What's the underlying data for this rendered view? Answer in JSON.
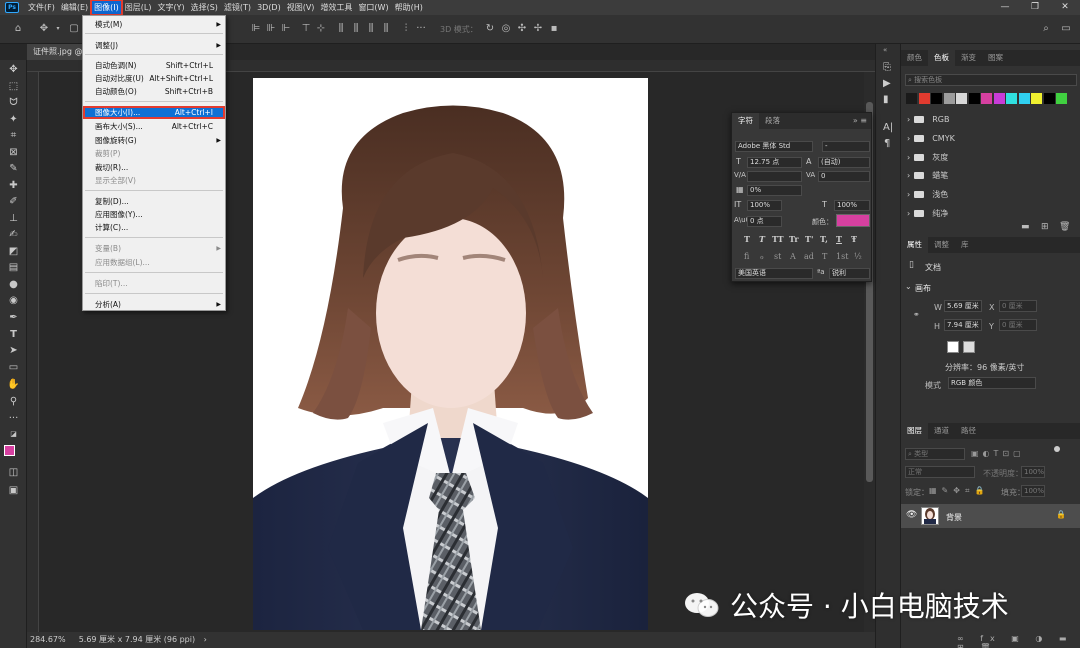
{
  "menubar": {
    "items": [
      "文件(F)",
      "编辑(E)",
      "图像(I)",
      "图层(L)",
      "文字(Y)",
      "选择(S)",
      "滤镜(T)",
      "3D(D)",
      "视图(V)",
      "增效工具",
      "窗口(W)",
      "帮助(H)"
    ],
    "active_index": 2
  },
  "options_bar": {
    "mode_3d": "3D 模式："
  },
  "document": {
    "tab_title": "证件照.jpg @"
  },
  "image_menu": {
    "items": [
      {
        "label": "模式(M)",
        "shortcut": "",
        "submenu": true,
        "disabled": false
      },
      {
        "label": "调整(J)",
        "shortcut": "",
        "submenu": true,
        "disabled": false
      },
      {
        "label": "自动色调(N)",
        "shortcut": "Shift+Ctrl+L",
        "submenu": false,
        "disabled": false
      },
      {
        "label": "自动对比度(U)",
        "shortcut": "Alt+Shift+Ctrl+L",
        "submenu": false,
        "disabled": false
      },
      {
        "label": "自动颜色(O)",
        "shortcut": "Shift+Ctrl+B",
        "submenu": false,
        "disabled": false
      },
      {
        "label": "图像大小(I)...",
        "shortcut": "Alt+Ctrl+I",
        "submenu": false,
        "disabled": false,
        "highlighted": true
      },
      {
        "label": "画布大小(S)...",
        "shortcut": "Alt+Ctrl+C",
        "submenu": false,
        "disabled": false
      },
      {
        "label": "图像旋转(G)",
        "shortcut": "",
        "submenu": true,
        "disabled": false
      },
      {
        "label": "裁剪(P)",
        "shortcut": "",
        "submenu": false,
        "disabled": true
      },
      {
        "label": "裁切(R)...",
        "shortcut": "",
        "submenu": false,
        "disabled": false
      },
      {
        "label": "显示全部(V)",
        "shortcut": "",
        "submenu": false,
        "disabled": true
      },
      {
        "label": "复制(D)...",
        "shortcut": "",
        "submenu": false,
        "disabled": false
      },
      {
        "label": "应用图像(Y)...",
        "shortcut": "",
        "submenu": false,
        "disabled": false
      },
      {
        "label": "计算(C)...",
        "shortcut": "",
        "submenu": false,
        "disabled": false
      },
      {
        "label": "变量(B)",
        "shortcut": "",
        "submenu": true,
        "disabled": true
      },
      {
        "label": "应用数据组(L)...",
        "shortcut": "",
        "submenu": false,
        "disabled": true
      },
      {
        "label": "陷印(T)...",
        "shortcut": "",
        "submenu": false,
        "disabled": true
      },
      {
        "label": "分析(A)",
        "shortcut": "",
        "submenu": true,
        "disabled": false
      }
    ]
  },
  "character_panel": {
    "tabs": [
      "字符",
      "段落"
    ],
    "font_family": "Adobe 黑体 Std",
    "font_style": "-",
    "font_size": "12.75 点",
    "leading": "(自动)",
    "kerning": "",
    "tracking": "0",
    "scale_ratio": "0%",
    "vertical_scale": "100%",
    "horizontal_scale": "100%",
    "baseline_shift": "0 点",
    "color_label": "颜色：",
    "color": "#d640a0",
    "style_buttons": [
      "T",
      "T",
      "TT",
      "Tr",
      "T'",
      "T,",
      "T",
      "Ŧ"
    ],
    "opentype_buttons": [
      "fi",
      "ℴ",
      "st",
      "A",
      "ad",
      "T",
      "1st",
      "½"
    ],
    "language": "美国英语",
    "antialias": "锐利"
  },
  "color_panel": {
    "tabs": [
      "颜色",
      "色板",
      "渐变",
      "图案"
    ],
    "active_tab": "色板",
    "search_placeholder": "搜索色板",
    "swatches": [
      "#1a1a1a",
      "#e23b2f",
      "#000000",
      "#9c9c9c",
      "#d8d8d8",
      "#000000",
      "#d640a0",
      "#c83cd8",
      "#30e0e0",
      "#30d0f0",
      "#f0f030",
      "#000000",
      "#40d040"
    ],
    "folders": [
      "RGB",
      "CMYK",
      "灰度",
      "蜡笔",
      "浅色",
      "纯净"
    ]
  },
  "properties_panel": {
    "tabs": [
      "属性",
      "调整",
      "库"
    ],
    "doc_label": "文档",
    "section": "画布",
    "w_label": "W",
    "w_value": "5.69 厘米",
    "x_label": "X",
    "x_value": "0 厘米",
    "h_label": "H",
    "h_value": "7.94 厘米",
    "y_label": "Y",
    "y_value": "0 厘米",
    "resolution": "分辨率：96 像素/英寸",
    "mode_label": "模式",
    "mode_value": "RGB 颜色"
  },
  "layers_panel": {
    "tabs": [
      "图层",
      "通道",
      "路径"
    ],
    "filter_placeholder": "类型",
    "blend_mode": "正常",
    "opacity_label": "不透明度：",
    "opacity_value": "100%",
    "lock_label": "锁定：",
    "fill_label": "填充：",
    "fill_value": "100%",
    "layer_name": "背景"
  },
  "statusbar": {
    "zoom": "284.67%",
    "doc_info": "5.69 厘米 x 7.94 厘米 (96 ppi)"
  },
  "watermark": {
    "text": "公众号 · 小白电脑技术"
  }
}
